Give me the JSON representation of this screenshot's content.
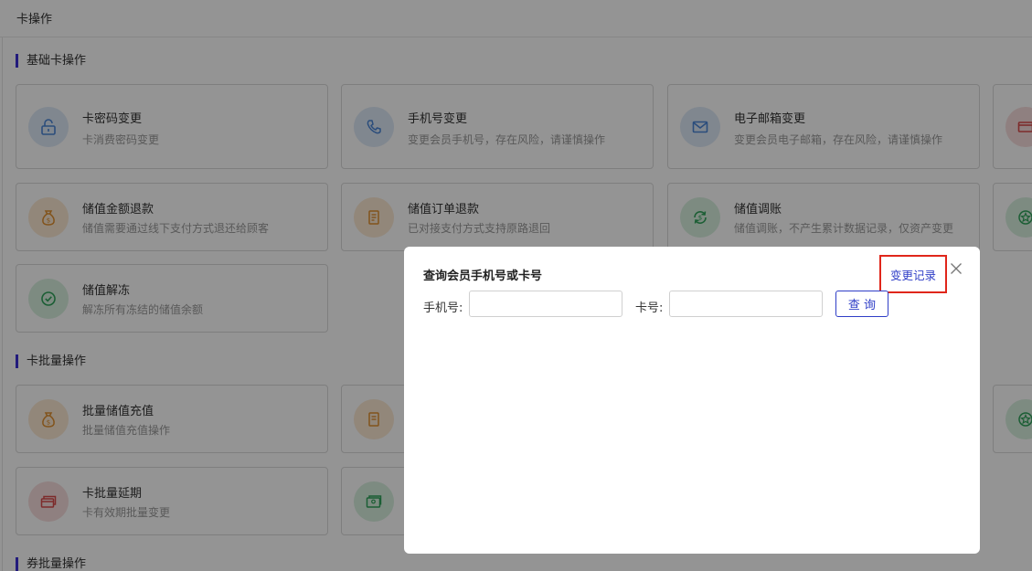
{
  "page": {
    "title": "卡操作"
  },
  "sections": {
    "basic": "基础卡操作",
    "batch": "卡批量操作",
    "coupon": "券批量操作"
  },
  "cards": {
    "pwd": {
      "title": "卡密码变更",
      "desc": "卡消费密码变更"
    },
    "phone": {
      "title": "手机号变更",
      "desc": "变更会员手机号，存在风险，请谨慎操作"
    },
    "email": {
      "title": "电子邮箱变更",
      "desc": "变更会员电子邮箱，存在风险，请谨慎操作"
    },
    "refund_amount": {
      "title": "储值金额退款",
      "desc": "储值需要通过线下支付方式退还给顾客"
    },
    "refund_order": {
      "title": "储值订单退款",
      "desc": "已对接支付方式支持原路退回"
    },
    "adjust": {
      "title": "储值调账",
      "desc": "储值调账，不产生累计数据记录，仅资产变更"
    },
    "unfreeze": {
      "title": "储值解冻",
      "desc": "解冻所有冻结的储值余额"
    },
    "batch_recharge": {
      "title": "批量储值充值",
      "desc": "批量储值充值操作"
    },
    "batch_extend": {
      "title": "卡批量延期",
      "desc": "卡有效期批量变更"
    }
  },
  "modal": {
    "title": "查询会员手机号或卡号",
    "history_link": "变更记录",
    "phone_label": "手机号:",
    "card_label": "卡号:",
    "phone_value": "",
    "card_value": "",
    "query_button": "查 询"
  },
  "colors": {
    "accent": "#2f3ec7",
    "section_bar": "#3b2fd6",
    "highlight_box": "#e0261b",
    "icon_blue": "#4a86d6",
    "icon_orange": "#e0902f",
    "icon_green": "#2fa35a",
    "icon_red": "#d84a4a"
  },
  "icons": {
    "pwd": "unlock-icon",
    "phone": "phone-icon",
    "email": "mail-icon",
    "refund_amount": "money-bag-icon",
    "refund_order": "receipt-icon",
    "adjust": "refresh-money-icon",
    "unfreeze": "check-circle-icon",
    "batch_recharge": "money-bag-icon",
    "batch_extend": "card-stack-icon",
    "close": "close-icon"
  }
}
